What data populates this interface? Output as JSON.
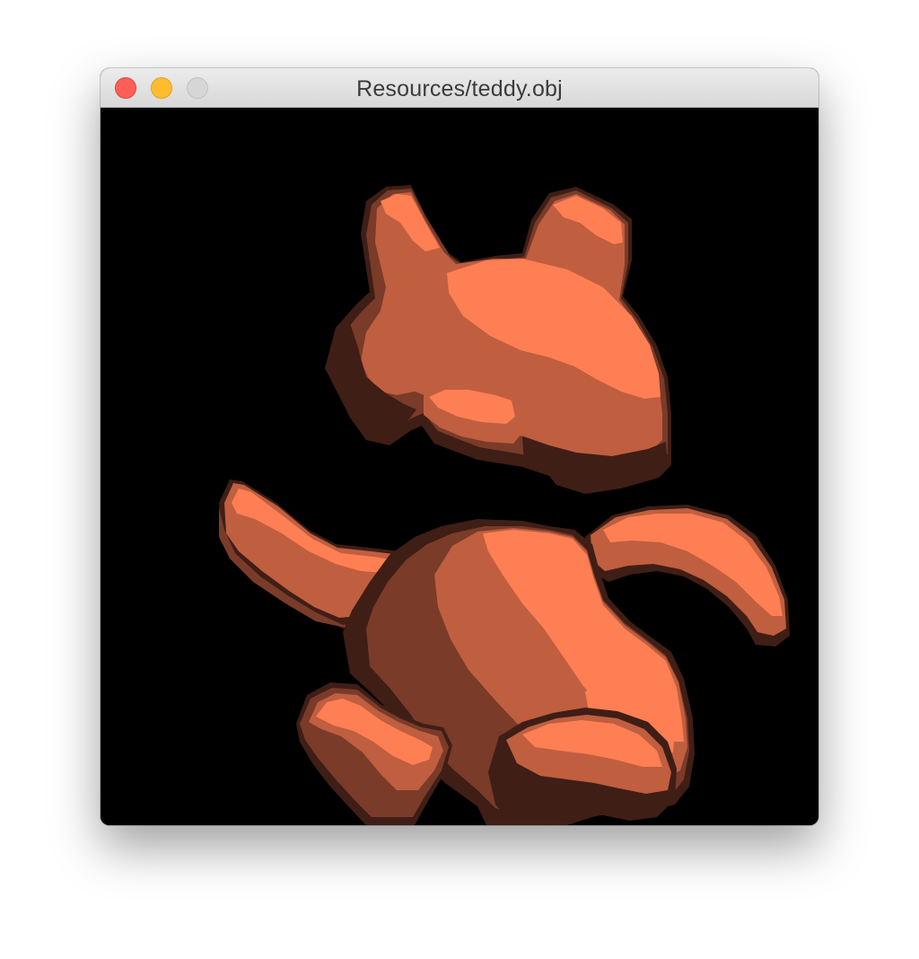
{
  "window": {
    "title": "Resources/teddy.obj",
    "controls": {
      "close": {
        "icon": "close-traffic-light-icon",
        "color": "#ff5f57"
      },
      "minimize": {
        "icon": "minimize-traffic-light-icon",
        "color": "#febc2e"
      },
      "zoom": {
        "icon": "zoom-traffic-light-icon-disabled",
        "color": "#d6d6d6"
      }
    }
  },
  "scene": {
    "background": "#000000",
    "model": "teddy bear mesh (toon shaded)",
    "shades": {
      "highlight": "#fe7f53",
      "mid": "#c05e40",
      "dark": "#7a3b29",
      "shadow": "#3f1e16"
    }
  }
}
